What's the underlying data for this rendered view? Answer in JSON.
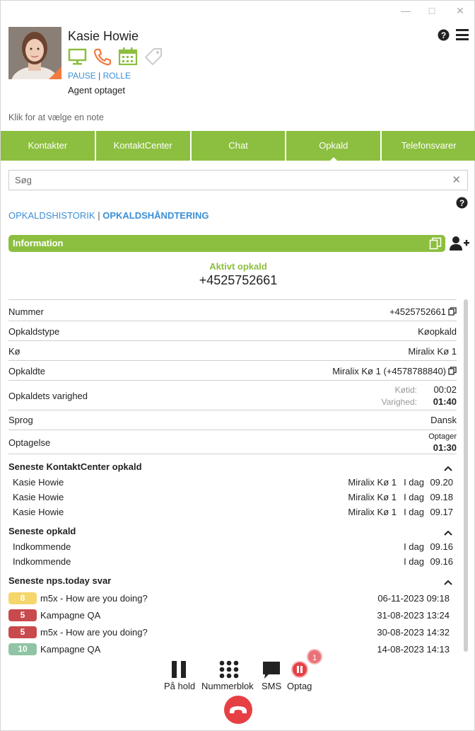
{
  "agent": {
    "name": "Kasie Howie",
    "pause_label": "PAUSE",
    "separator": "|",
    "role_label": "ROLLE",
    "status": "Agent optaget"
  },
  "note_placeholder": "Klik for at vælge en note",
  "tabs": [
    {
      "label": "Kontakter"
    },
    {
      "label": "KontaktCenter"
    },
    {
      "label": "Chat"
    },
    {
      "label": "Opkald",
      "active": true
    },
    {
      "label": "Telefonsvarer"
    }
  ],
  "search": {
    "placeholder": "Søg"
  },
  "subnav": {
    "history": "OPKALDSHISTORIK",
    "separator": "|",
    "handling": "OPKALDSHÅNDTERING"
  },
  "info": {
    "header": "Information",
    "active_call_label": "Aktivt opkald",
    "active_call_number": "+4525752661",
    "rows": {
      "number": {
        "label": "Nummer",
        "value": "+4525752661"
      },
      "call_type": {
        "label": "Opkaldstype",
        "value": "Køopkald"
      },
      "queue": {
        "label": "Kø",
        "value": "Miralix Kø 1"
      },
      "called": {
        "label": "Opkaldte",
        "value": "Miralix Kø 1 (+4578788840)"
      },
      "duration": {
        "label": "Opkaldets varighed",
        "queue_time_label": "Køtid:",
        "queue_time": "00:02",
        "duration_label": "Varighed:",
        "duration": "01:40"
      },
      "language": {
        "label": "Sprog",
        "value": "Dansk"
      },
      "recording": {
        "label": "Optagelse",
        "status": "Optager",
        "time": "01:30"
      }
    }
  },
  "recent_cc": {
    "title": "Seneste KontaktCenter opkald",
    "items": [
      {
        "name": "Kasie Howie",
        "queue": "Miralix Kø 1",
        "day": "I dag",
        "time": "09.20"
      },
      {
        "name": "Kasie Howie",
        "queue": "Miralix Kø 1",
        "day": "I dag",
        "time": "09.18"
      },
      {
        "name": "Kasie Howie",
        "queue": "Miralix Kø 1",
        "day": "I dag",
        "time": "09.17"
      }
    ]
  },
  "recent_calls": {
    "title": "Seneste opkald",
    "items": [
      {
        "direction": "Indkommende",
        "day": "I dag",
        "time": "09.16"
      },
      {
        "direction": "Indkommende",
        "day": "I dag",
        "time": "09.16"
      }
    ]
  },
  "nps": {
    "title": "Seneste nps.today svar",
    "items": [
      {
        "score": "8",
        "color": "#f5d66b",
        "question": "m5x - How are you doing?",
        "date": "06-11-2023 09:18"
      },
      {
        "score": "5",
        "color": "#c94a4c",
        "question": "Kampagne QA",
        "date": "31-08-2023 13:24"
      },
      {
        "score": "5",
        "color": "#c94a4c",
        "question": "m5x - How are you doing?",
        "date": "30-08-2023 14:32"
      },
      {
        "score": "10",
        "color": "#8fc4a4",
        "question": "Kampagne QA",
        "date": "14-08-2023 14:13"
      }
    ]
  },
  "controls": {
    "hold": "På hold",
    "keypad": "Nummerblok",
    "sms": "SMS",
    "record": "Optag",
    "record_badge": "1"
  },
  "colors": {
    "accent": "#8cbf3f",
    "link": "#3b8fd6",
    "phone": "#f07b3f",
    "hangup": "#e64044"
  }
}
